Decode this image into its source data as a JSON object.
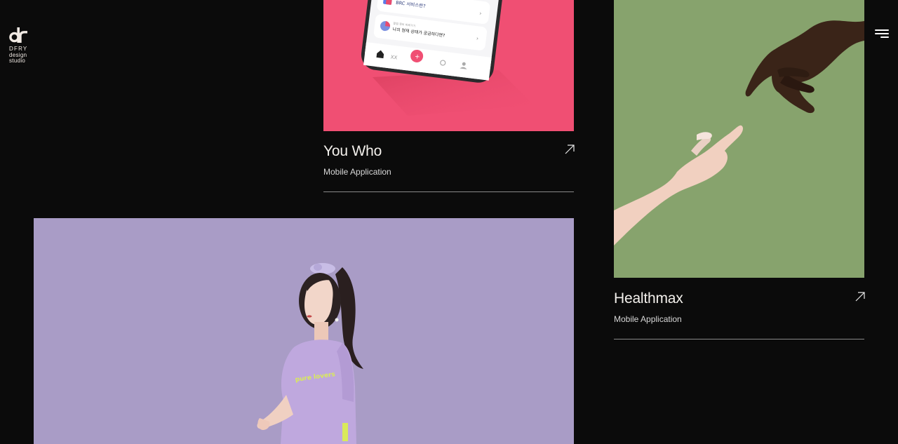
{
  "logo": {
    "mark": "dr",
    "line1": "DFRY",
    "line2": "design",
    "line3": "studio"
  },
  "menu": {
    "icon": "hamburger-icon"
  },
  "colors": {
    "background": "#0b0b0b",
    "youwho_bg": "#f04f73",
    "healthmax_bg": "#87a36d",
    "lavender_bg": "#a99cc6"
  },
  "projects": [
    {
      "title": "You Who",
      "category": "Mobile Application",
      "arrow_icon": "arrow-up-right-icon",
      "phone_rows": [
        "BRC 서비스란?",
        "나의 현재 상태가 궁금하다면?"
      ],
      "phone_row_caption": "알림 정보 바로가기"
    },
    {
      "title": "Healthmax",
      "category": "Mobile Application",
      "arrow_icon": "arrow-up-right-icon"
    },
    {
      "shirt_text": "pure lovers"
    }
  ]
}
